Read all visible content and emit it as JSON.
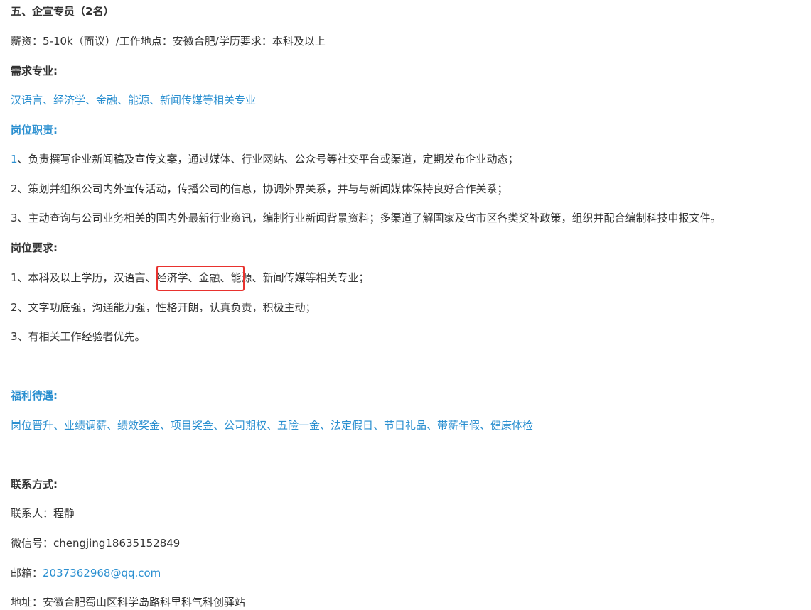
{
  "job": {
    "title": "五、企宣专员（2名）",
    "salary_line": "薪资：5-10k（面议）/工作地点：安徽合肥/学历要求：本科及以上"
  },
  "major": {
    "heading": "需求专业:",
    "text": "汉语言、经济学、金融、能源、新闻传媒等相关专业"
  },
  "duties": {
    "heading": "岗位职责:",
    "items": [
      {
        "num": "1",
        "text": "、负责撰写企业新闻稿及宣传文案，通过媒体、行业网站、公众号等社交平台或渠道，定期发布企业动态；"
      },
      {
        "num": "2",
        "text": "、策划并组织公司内外宣传活动，传播公司的信息，协调外界关系，并与与新闻媒体保持良好合作关系；"
      },
      {
        "num": "3",
        "text": "、主动查询与公司业务相关的国内外最新行业资讯，编制行业新闻背景资料；多渠道了解国家及省市区各类奖补政策，组织并配合编制科技申报文件。"
      }
    ]
  },
  "requirements": {
    "heading": "岗位要求:",
    "items": [
      "1、本科及以上学历，汉语言、经济学、金融、能源、新闻传媒等相关专业；",
      "2、文字功底强，沟通能力强，性格开朗，认真负责，积极主动；",
      "3、有相关工作经验者优先。"
    ]
  },
  "benefits": {
    "heading": "福利待遇:",
    "text": "岗位晋升、业绩调薪、绩效奖金、项目奖金、公司期权、五险一金、法定假日、节日礼品、带薪年假、健康体检"
  },
  "contact": {
    "heading": "联系方式:",
    "person": "联系人：程静",
    "wechat": "微信号：chengjing18635152849",
    "email_label": "邮箱：",
    "email": "2037362968@qq.com",
    "address": "地址：安徽合肥蜀山区科学岛路科里科气科创驿站"
  },
  "colors": {
    "accent_blue": "#2a8fd0",
    "highlight_red": "#e8322e",
    "text": "#333333"
  }
}
